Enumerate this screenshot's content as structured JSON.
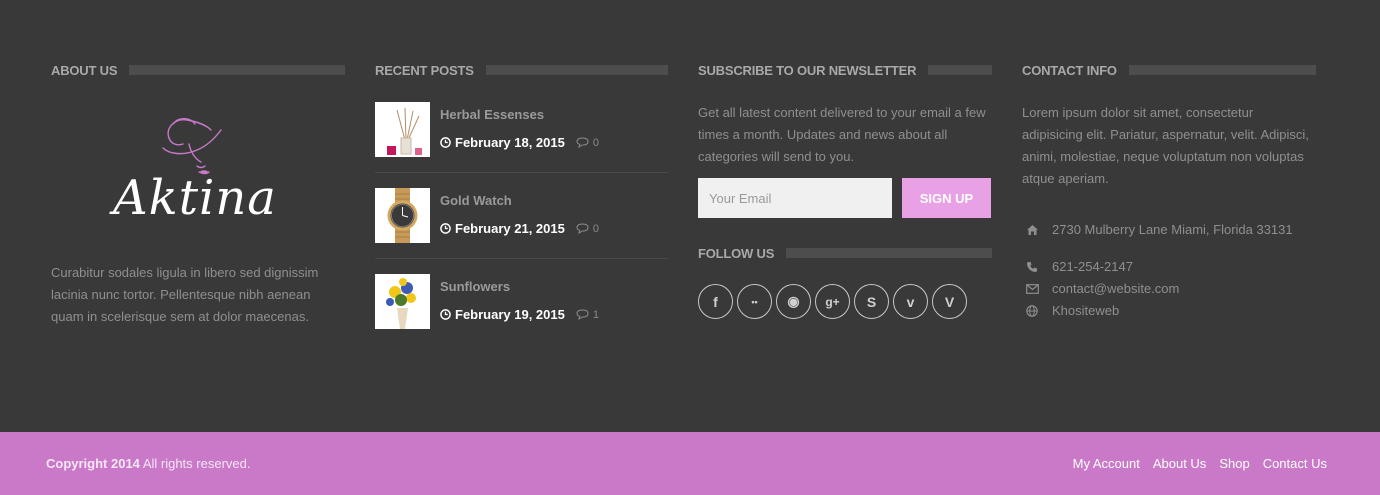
{
  "about": {
    "title": "ABOUT US",
    "logo_text": "Aktina",
    "text": "Curabitur sodales ligula in libero sed dignissim lacinia nunc tortor. Pellentesque nibh aenean quam in scelerisque sem at dolor maecenas."
  },
  "recent_posts": {
    "title": "RECENT POSTS",
    "items": [
      {
        "title": "Herbal Essenses",
        "date": "February 18, 2015",
        "comments": "0",
        "thumb": "perfume-diffuser"
      },
      {
        "title": "Gold Watch",
        "date": "February 21, 2015",
        "comments": "0",
        "thumb": "gold-watch"
      },
      {
        "title": "Sunflowers",
        "date": "February 19, 2015",
        "comments": "1",
        "thumb": "flower-bouquet"
      }
    ]
  },
  "newsletter": {
    "title": "SUBSCRIBE TO OUR NEWSLETTER",
    "text": "Get all latest content delivered to your email a few times a month. Updates and news about all categories will send to you.",
    "email_placeholder": "Your Email",
    "button": "SIGN UP",
    "follow_title": "FOLLOW US",
    "socials": [
      {
        "name": "facebook-icon",
        "glyph": "f"
      },
      {
        "name": "flickr-icon",
        "glyph": "••"
      },
      {
        "name": "github-icon",
        "glyph": "◉"
      },
      {
        "name": "google-plus-icon",
        "glyph": "g+"
      },
      {
        "name": "skype-icon",
        "glyph": "S"
      },
      {
        "name": "vimeo-icon",
        "glyph": "v"
      },
      {
        "name": "vine-icon",
        "glyph": "V"
      }
    ]
  },
  "contact": {
    "title": "CONTACT INFO",
    "text": "Lorem ipsum dolor sit amet, consectetur adipisicing elit. Pariatur, aspernatur, velit. Adipisci, animi, molestiae, neque voluptatum non voluptas atque aperiam.",
    "address": "2730 Mulberry Lane Miami, Florida 33131",
    "phone": "621-254-2147",
    "email": "contact@website.com",
    "website": "Khositeweb"
  },
  "footer": {
    "copyright_bold": "Copyright 2014",
    "copyright_rest": " All rights reserved.",
    "nav": [
      "My Account",
      "About Us",
      "Shop",
      "Contact Us"
    ]
  },
  "colors": {
    "background": "#393939",
    "accent_pink": "#c979c8",
    "button_pink": "#e9a1e6"
  }
}
